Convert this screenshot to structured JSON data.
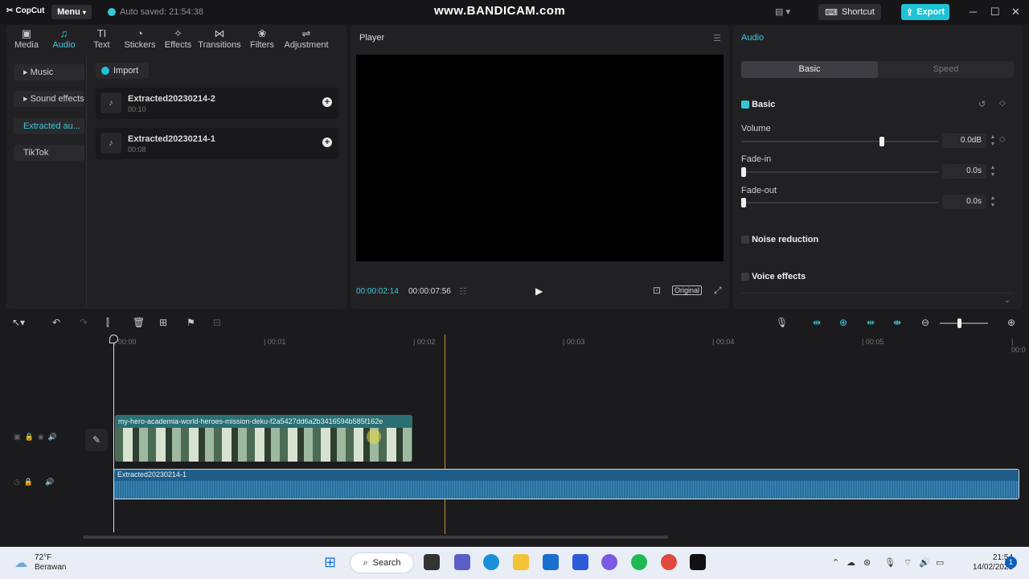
{
  "app": {
    "logo": "CopCut",
    "menu": "Menu",
    "autosave": "Auto saved: 21:54:38",
    "watermark": "www.BANDICAM.com",
    "shortcut": "Shortcut",
    "export": "Export"
  },
  "tabs": [
    {
      "label": "Media",
      "icon": "▣"
    },
    {
      "label": "Audio",
      "icon": "♫"
    },
    {
      "label": "Text",
      "icon": "TI"
    },
    {
      "label": "Stickers",
      "icon": "◔"
    },
    {
      "label": "Effects",
      "icon": "✧"
    },
    {
      "label": "Transitions",
      "icon": "⋈"
    },
    {
      "label": "Filters",
      "icon": "❀"
    },
    {
      "label": "Adjustment",
      "icon": "⇌"
    }
  ],
  "sidebar": [
    "Music",
    "Sound effects",
    "Extracted au...",
    "TikTok"
  ],
  "import": "Import",
  "files": [
    {
      "name": "Extracted20230214-2",
      "duration": "00:10"
    },
    {
      "name": "Extracted20230214-1",
      "duration": "00:08"
    }
  ],
  "player": {
    "title": "Player",
    "current": "00:00:02:14",
    "total": "00:00:07:56",
    "original": "Original"
  },
  "audio": {
    "title": "Audio",
    "tab_basic": "Basic",
    "tab_speed": "Speed",
    "section": "Basic",
    "volume_label": "Volume",
    "volume": "0.0dB",
    "volume_level": 0.7,
    "fadein_label": "Fade-in",
    "fadein": "0.0s",
    "fadeout_label": "Fade-out",
    "fadeout": "0.0s",
    "noise": "Noise reduction",
    "voice": "Voice effects"
  },
  "timeline": {
    "ticks": [
      "00:00",
      "00:01",
      "00:02",
      "00:03",
      "00:04",
      "00:05",
      "00:0"
    ],
    "video_clip": "my-hero-academia-world-heroes-mission-deku-f2a5427dd6a2b3416594b585f162e",
    "audio_clip": "Extracted20230214-1"
  },
  "taskbar": {
    "temp": "72°F",
    "weather": "Berawan",
    "search": "Search",
    "time": "21:54",
    "date": "14/02/2023",
    "notif": "1"
  }
}
